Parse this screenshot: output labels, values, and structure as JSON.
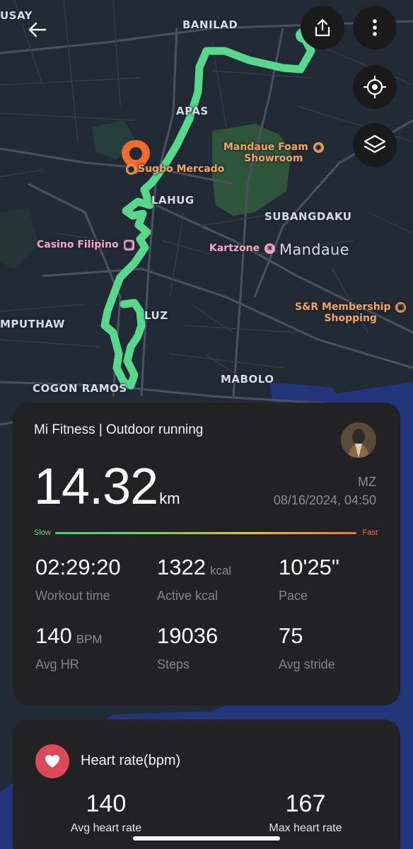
{
  "map": {
    "places": {
      "usay": "USAY",
      "banilad": "BANILAD",
      "apas": "APAS",
      "lahug": "LAHUG",
      "subangdaku": "SUBANGDAKU",
      "mandaue": "Mandaue",
      "luz": "LUZ",
      "mputhaw": "MPUTHAW",
      "mabolo": "MABOLO",
      "cogon_ramos": "COGON RAMOS"
    },
    "pois": {
      "sugbo": "Sugbo Mercado",
      "mandaue_foam_1": "Mandaue Foam",
      "mandaue_foam_2": "Showroom",
      "casino": "Casino Filipino",
      "kartzone": "Kartzone",
      "snr_1": "S&R Membership",
      "snr_2": "Shopping"
    },
    "route_color": "#56d98a",
    "pin_color": "#f26b2a"
  },
  "controls": {
    "back_icon": "arrow-left-icon",
    "share_icon": "share-icon",
    "more_icon": "more-vertical-icon",
    "locate_icon": "locate-icon",
    "layers_icon": "layers-icon"
  },
  "summary": {
    "app_line": "Mi Fitness | Outdoor running",
    "distance_value": "14.32",
    "distance_unit": "km",
    "user_initials": "MZ",
    "datetime": "08/16/2024, 04:50",
    "pace_slow": "Slow",
    "pace_fast": "Fast",
    "stats": [
      {
        "value": "02:29:20",
        "unit": "",
        "label": "Workout time"
      },
      {
        "value": "1322",
        "unit": "kcal",
        "label": "Active kcal"
      },
      {
        "value": "10'25\"",
        "unit": "",
        "label": "Pace"
      },
      {
        "value": "140",
        "unit": "BPM",
        "label": "Avg HR"
      },
      {
        "value": "19036",
        "unit": "",
        "label": "Steps"
      },
      {
        "value": "75",
        "unit": "",
        "label": "Avg stride"
      }
    ]
  },
  "heart_rate": {
    "title": "Heart rate(bpm)",
    "avg_value": "140",
    "avg_label": "Avg heart rate",
    "max_value": "167",
    "max_label": "Max heart rate"
  },
  "colors": {
    "card_bg": "#222224",
    "accent_red": "#dc4a5a",
    "route_green": "#56d98a"
  }
}
